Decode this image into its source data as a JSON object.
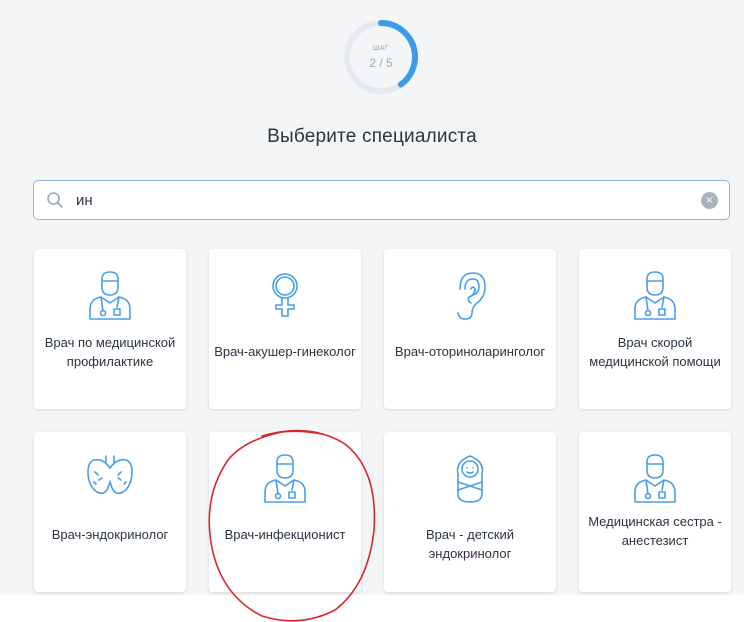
{
  "progress": {
    "step_label": "ШАГ",
    "step_value": "2 / 5",
    "fraction": 0.4
  },
  "page_title": "Выберите специалиста",
  "search": {
    "value": "ин",
    "placeholder": ""
  },
  "colors": {
    "accent": "#3d9be9",
    "icon": "#4a9ee8",
    "annotation": "#d8282a"
  },
  "specialists": [
    {
      "label": "Врач по медицинской профилактике",
      "icon": "doctor-icon"
    },
    {
      "label": "Врач-акушер-гинеколог",
      "icon": "female-symbol-icon"
    },
    {
      "label": "Врач-оториноларинголог",
      "icon": "ear-icon"
    },
    {
      "label": "Врач скорой медицинской помощи",
      "icon": "doctor-icon"
    },
    {
      "label": "Врач-эндокринолог",
      "icon": "thyroid-icon"
    },
    {
      "label": "Врач-инфекционист",
      "icon": "doctor-icon"
    },
    {
      "label": "Врач - детский эндокринолог",
      "icon": "swaddled-baby-icon"
    },
    {
      "label": "Медицинская сестра - анестезист",
      "icon": "doctor-icon"
    }
  ]
}
